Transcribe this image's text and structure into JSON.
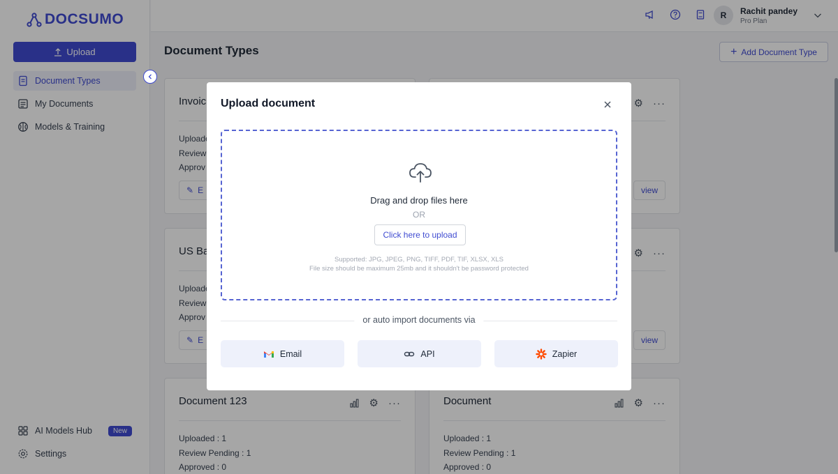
{
  "app": {
    "logo_text": "DOCSUMO"
  },
  "sidebar": {
    "upload_label": "Upload",
    "items": [
      {
        "label": "Document Types",
        "icon": "document-icon",
        "active": true
      },
      {
        "label": "My Documents",
        "icon": "documents-icon",
        "active": false
      },
      {
        "label": "Models & Training",
        "icon": "brain-icon",
        "active": false
      }
    ],
    "bottom": [
      {
        "label": "AI Models Hub",
        "icon": "grid-icon",
        "badge": "New"
      },
      {
        "label": "Settings",
        "icon": "gear-icon"
      }
    ]
  },
  "header": {
    "user_initial": "R",
    "user_name": "Rachit pandey",
    "user_plan": "Pro Plan",
    "icons": [
      "megaphone-icon",
      "help-icon",
      "book-icon",
      "chevron-down-icon"
    ]
  },
  "main": {
    "title": "Document Types",
    "add_button": "Add Document Type",
    "cards": [
      {
        "title": "Invoic",
        "stats": [
          "Uploade",
          "Review",
          "Approv"
        ],
        "btn_left": "E",
        "btn_right": ""
      },
      {
        "title": "",
        "stats": [],
        "btn_left": "",
        "btn_right": "view"
      },
      {
        "title": "US Ba",
        "stats": [
          "Uploade",
          "Review",
          "Approv"
        ],
        "btn_left": "E",
        "btn_right": ""
      },
      {
        "title": "",
        "stats": [],
        "btn_left": "",
        "btn_right": "view"
      },
      {
        "title": "Document 123",
        "stats": [
          "Uploaded :  1",
          "Review Pending :  1",
          "Approved :  0"
        ]
      },
      {
        "title": "Document",
        "stats": [
          "Uploaded :  1",
          "Review Pending :  1",
          "Approved :  0"
        ]
      }
    ]
  },
  "modal": {
    "title": "Upload document",
    "drag_text": "Drag and drop files here",
    "or_text": "OR",
    "click_upload": "Click here to upload",
    "supported_line1": "Supported: JPG, JPEG, PNG, TIFF, PDF, TIF, XLSX, XLS",
    "supported_line2": "File size should be maximum 25mb and it shouldn't be password protected",
    "auto_import": "or auto import documents via",
    "import_options": [
      {
        "label": "Email",
        "icon": "gmail-icon"
      },
      {
        "label": "API",
        "icon": "link-icon"
      },
      {
        "label": "Zapier",
        "icon": "zapier-icon"
      }
    ]
  },
  "colors": {
    "brand": "#3f4bd1",
    "zapier": "#ff4a00"
  }
}
